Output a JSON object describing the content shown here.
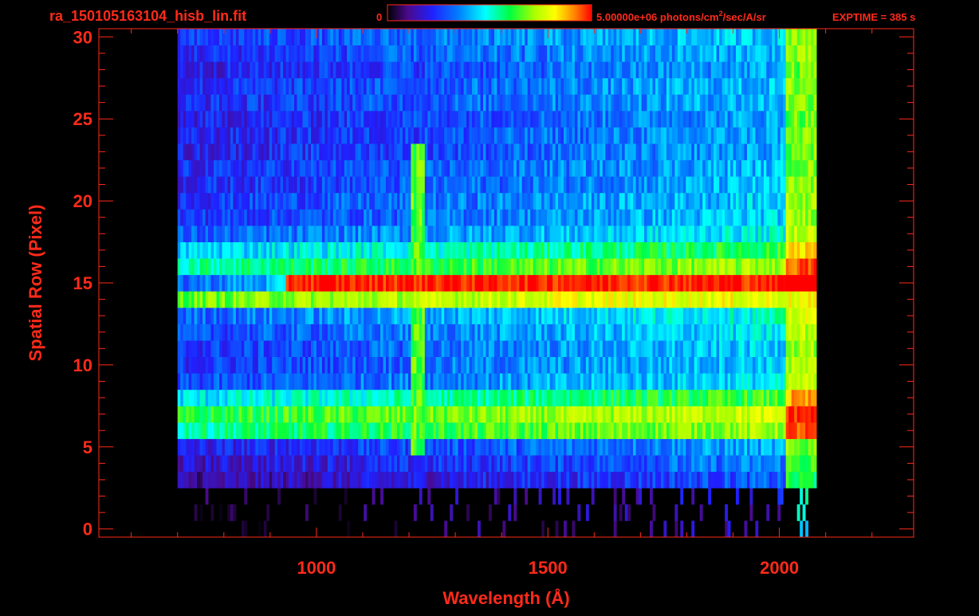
{
  "header": {
    "filename": "ra_150105163104_hisb_lin.fit",
    "colorbar_min_label": "0",
    "colorbar_max_label": "5.00000e+06 photons/cm",
    "colorbar_max_exp": "2",
    "colorbar_max_rest": "/sec/A/sr",
    "exptime": "EXPTIME = 385 s"
  },
  "colors": {
    "text": "#ff2a1a",
    "axis": "#ff2a1a",
    "background": "#000000",
    "colormap": [
      "#000000",
      "#4a0a8c",
      "#2020ff",
      "#0080ff",
      "#00ffff",
      "#00ff40",
      "#aaff00",
      "#ffff00",
      "#ff8000",
      "#ff0000"
    ]
  },
  "chart_data": {
    "type": "heatmap",
    "title": "",
    "xlabel": "Wavelength (Å)",
    "ylabel": "Spatial Row (Pixel)",
    "xlim": [
      530,
      2290
    ],
    "ylim": [
      -0.5,
      30.5
    ],
    "x_ticks": [
      1000,
      1500,
      2000
    ],
    "y_ticks": [
      0,
      5,
      10,
      15,
      20,
      25,
      30
    ],
    "colorbar": {
      "min": 0,
      "max": 5000000,
      "units": "photons/cm^2/sec/A/sr"
    },
    "data_extent_wavelength": [
      700,
      2080
    ],
    "spectral_line_wavelength": 1216,
    "rows": [
      {
        "row": 0,
        "level": 0.0
      },
      {
        "row": 1,
        "level": 0.02
      },
      {
        "row": 2,
        "level": 0.04
      },
      {
        "row": 3,
        "level": 0.12
      },
      {
        "row": 4,
        "level": 0.16
      },
      {
        "row": 5,
        "level": 0.2
      },
      {
        "row": 6,
        "level": 0.5
      },
      {
        "row": 7,
        "level": 0.55
      },
      {
        "row": 8,
        "level": 0.42
      },
      {
        "row": 9,
        "level": 0.26
      },
      {
        "row": 10,
        "level": 0.24
      },
      {
        "row": 11,
        "level": 0.24
      },
      {
        "row": 12,
        "level": 0.26
      },
      {
        "row": 13,
        "level": 0.3
      },
      {
        "row": 14,
        "level": 0.62
      },
      {
        "row": 15,
        "level": 0.98
      },
      {
        "row": 16,
        "level": 0.5
      },
      {
        "row": 17,
        "level": 0.4
      },
      {
        "row": 18,
        "level": 0.28
      },
      {
        "row": 19,
        "level": 0.24
      },
      {
        "row": 20,
        "level": 0.24
      },
      {
        "row": 21,
        "level": 0.22
      },
      {
        "row": 22,
        "level": 0.22
      },
      {
        "row": 23,
        "level": 0.2
      },
      {
        "row": 24,
        "level": 0.2
      },
      {
        "row": 25,
        "level": 0.2
      },
      {
        "row": 26,
        "level": 0.22
      },
      {
        "row": 27,
        "level": 0.22
      },
      {
        "row": 28,
        "level": 0.2
      },
      {
        "row": 29,
        "level": 0.22
      },
      {
        "row": 30,
        "level": 0.24
      }
    ]
  }
}
